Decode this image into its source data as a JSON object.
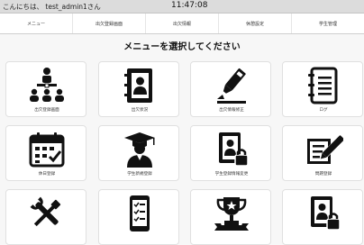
{
  "header": {
    "greeting": "こんにちは、 test_admin1さん",
    "time": "11:47:08"
  },
  "nav": {
    "items": [
      "メニュー",
      "出欠登録画面",
      "出欠情報",
      "休憩設定",
      "学生管理"
    ]
  },
  "page_title": "メニューを選択してください",
  "tiles": [
    {
      "label": "出欠登録画面",
      "icon": "meeting-icon"
    },
    {
      "label": "出欠状況",
      "icon": "contact-book-icon"
    },
    {
      "label": "出欠情報修正",
      "icon": "highlighter-icon"
    },
    {
      "label": "ログ",
      "icon": "notebook-icon"
    },
    {
      "label": "休日登録",
      "icon": "calendar-check-icon"
    },
    {
      "label": "学生新規登録",
      "icon": "graduate-icon"
    },
    {
      "label": "学生登録情報変更",
      "icon": "locked-contact-icon"
    },
    {
      "label": "問題登録",
      "icon": "edit-document-icon"
    },
    {
      "label": "",
      "icon": "tools-icon"
    },
    {
      "label": "",
      "icon": "phone-checklist-icon"
    },
    {
      "label": "",
      "icon": "trophy-icon"
    },
    {
      "label": "",
      "icon": "locked-user-book-icon"
    }
  ]
}
